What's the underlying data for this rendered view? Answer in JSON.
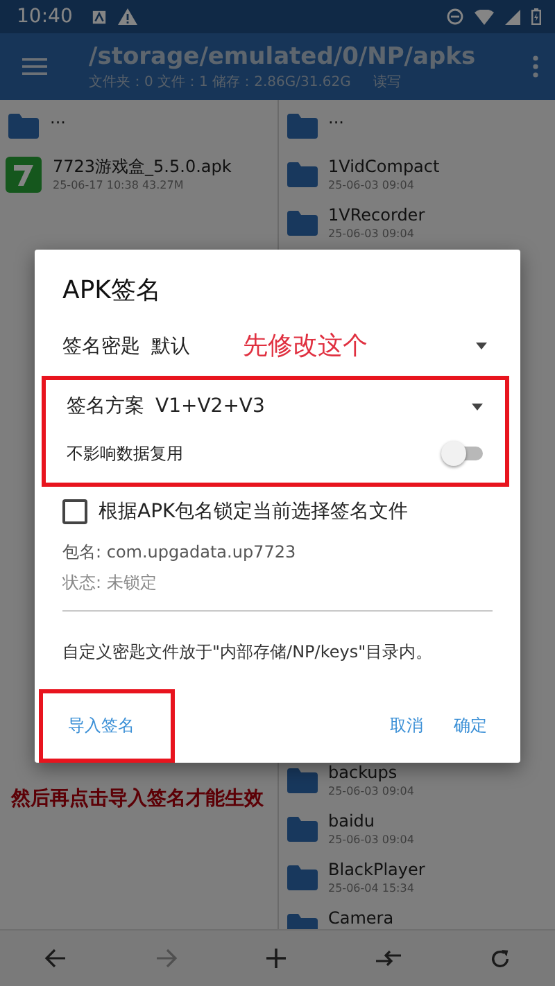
{
  "status_bar": {
    "time": "10:40"
  },
  "toolbar": {
    "path": "/storage/emulated/0/NP/apks",
    "info": "文件夹：0 文件：1 储存：2.86G/31.62G",
    "mode": "读写"
  },
  "left_pane": {
    "items": [
      {
        "kind": "folder",
        "name": "..."
      },
      {
        "kind": "apk",
        "name": "7723游戏盒_5.5.0.apk",
        "meta": "25-06-17 10:38  43.27M"
      }
    ]
  },
  "right_pane": {
    "top_items": [
      {
        "kind": "folder",
        "name": "..."
      },
      {
        "kind": "folder",
        "name": "1VidCompact",
        "meta": "25-06-03 09:04"
      },
      {
        "kind": "folder",
        "name": "1VRecorder",
        "meta": "25-06-03 09:04"
      }
    ],
    "bottom_items": [
      {
        "kind": "folder",
        "name": "backups",
        "meta": "25-06-03 09:04"
      },
      {
        "kind": "folder",
        "name": "baidu",
        "meta": "25-06-03 09:04"
      },
      {
        "kind": "folder",
        "name": "BlackPlayer",
        "meta": "25-06-04 15:34"
      },
      {
        "kind": "folder",
        "name": "Camera"
      }
    ]
  },
  "dialog": {
    "title": "APK签名",
    "key": {
      "label": "签名密匙",
      "value": "默认"
    },
    "scheme": {
      "label": "签名方案",
      "value": "V1+V2+V3"
    },
    "toggle": {
      "label": "不影响数据复用",
      "on": false
    },
    "checkbox": {
      "label": "根据APK包名锁定当前选择签名文件",
      "checked": false
    },
    "package": "包名: com.upgadata.up7723",
    "status": "状态: 未锁定",
    "note": "自定义密匙文件放于\"内部存储/NP/keys\"目录内。",
    "buttons": {
      "import": "导入签名",
      "cancel": "取消",
      "ok": "确定"
    }
  },
  "annotations": {
    "first": "先修改这个",
    "then": "然后再点击导入签名才能生效"
  }
}
